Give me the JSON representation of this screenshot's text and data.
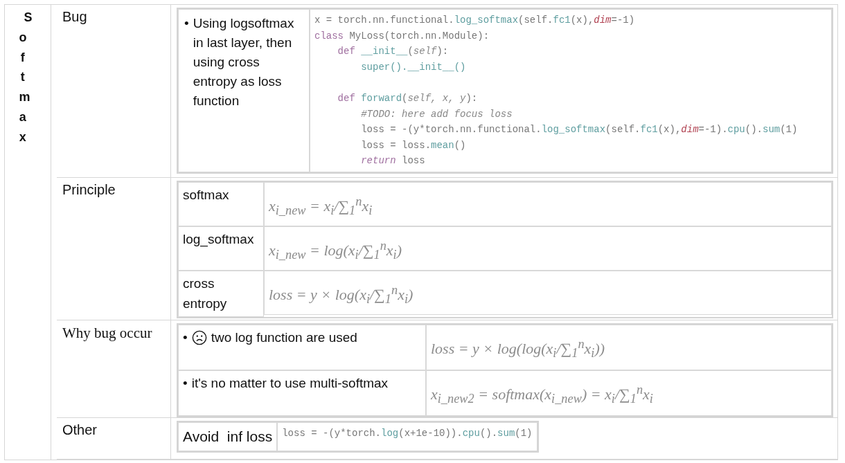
{
  "side_title": "Softmax",
  "sections": [
    {
      "kind": "bug",
      "label": "Bug",
      "mark": "•",
      "bullet": "Using logsoftmax in last layer, then using cross entropy as loss function",
      "code": [
        {
          "tokens": [
            {
              "t": "x = torch.nn.functional.",
              "kind": "plain"
            },
            {
              "t": "log_softmax",
              "kind": "func"
            },
            {
              "t": "(self.",
              "kind": "plain"
            },
            {
              "t": "fc1",
              "kind": "func"
            },
            {
              "t": "(x),",
              "kind": "plain"
            },
            {
              "t": "dim",
              "kind": "param"
            },
            {
              "t": "=-1)",
              "kind": "plain"
            }
          ]
        },
        {
          "tokens": [
            {
              "t": "class ",
              "kind": "keyword"
            },
            {
              "t": "MyLoss(torch.nn.Module):",
              "kind": "plain"
            }
          ]
        },
        {
          "tokens": [
            {
              "t": "    def ",
              "kind": "keyword"
            },
            {
              "t": "__init__",
              "kind": "func"
            },
            {
              "t": "(",
              "kind": "plain"
            },
            {
              "t": "self",
              "kind": "comment"
            },
            {
              "t": "):",
              "kind": "plain"
            }
          ]
        },
        {
          "tokens": [
            {
              "t": "        super().__init__()",
              "kind": "func"
            }
          ]
        },
        {
          "gap_before": true,
          "tokens": [
            {
              "t": "    def ",
              "kind": "keyword"
            },
            {
              "t": "forward",
              "kind": "func"
            },
            {
              "t": "(",
              "kind": "plain"
            },
            {
              "t": "self, x, y",
              "kind": "comment"
            },
            {
              "t": "):",
              "kind": "plain"
            }
          ]
        },
        {
          "tokens": [
            {
              "t": "        #TODO: here add focus loss",
              "kind": "comment"
            }
          ]
        },
        {
          "tokens": [
            {
              "t": "        loss = -(y*torch.nn.functional.",
              "kind": "plain"
            },
            {
              "t": "log_softmax",
              "kind": "func"
            },
            {
              "t": "(self.",
              "kind": "plain"
            },
            {
              "t": "fc1",
              "kind": "func"
            },
            {
              "t": "(x),",
              "kind": "plain"
            },
            {
              "t": "dim",
              "kind": "param"
            },
            {
              "t": "=-1).",
              "kind": "plain"
            },
            {
              "t": "cpu",
              "kind": "func"
            },
            {
              "t": "().",
              "kind": "plain"
            },
            {
              "t": "sum",
              "kind": "func"
            },
            {
              "t": "(1)",
              "kind": "plain"
            }
          ]
        },
        {
          "tokens": [
            {
              "t": "        loss = loss.",
              "kind": "plain"
            },
            {
              "t": "mean",
              "kind": "func"
            },
            {
              "t": "()",
              "kind": "plain"
            }
          ]
        },
        {
          "tokens": [
            {
              "t": "        return",
              "kind": "keyword_italic"
            },
            {
              "t": " loss",
              "kind": "plain"
            }
          ]
        }
      ]
    },
    {
      "kind": "principle",
      "label": "Principle",
      "rows": [
        {
          "name": "softmax",
          "formula": "x$_{i_new}$ = x$_{i}$/∑$_{1}$$^{n}$x$_{i}$"
        },
        {
          "name": "log_softmax",
          "formula": "x$_{i_new}$ = log(x$_{i}$/∑$_{1}$$^{n}$x$_{i}$)"
        },
        {
          "name": "cross entropy",
          "formula": "loss = y × log(x$_{i}$/∑$_{1}$$^{n}$x$_{i}$)"
        }
      ]
    },
    {
      "kind": "why",
      "label": "Why bug occur",
      "rows": [
        {
          "mark": "•",
          "bullet": "two log function are used",
          "sad": true,
          "formula": "loss = y × log(log(x$_{i}$/∑$_{1}$$^{n}$x$_{i}$))"
        },
        {
          "mark": "•",
          "bullet": "it's no matter to use multi-softmax",
          "sad": false,
          "formula": "x$_{i_new2}$ =  softmax(x$_{i_new}$) = x$_{i}$/∑$_{1}$$^{n}$x$_{i}$"
        }
      ]
    },
    {
      "kind": "other",
      "label": "Other",
      "text": "Avoid  inf loss",
      "code": [
        {
          "t": "loss = -(y*torch.",
          "kind": "plain"
        },
        {
          "t": "log",
          "kind": "func"
        },
        {
          "t": "(x+1e-10)).",
          "kind": "plain"
        },
        {
          "t": "cpu",
          "kind": "func"
        },
        {
          "t": "().",
          "kind": "plain"
        },
        {
          "t": "sum",
          "kind": "func"
        },
        {
          "t": "(1)",
          "kind": "plain"
        }
      ]
    }
  ]
}
